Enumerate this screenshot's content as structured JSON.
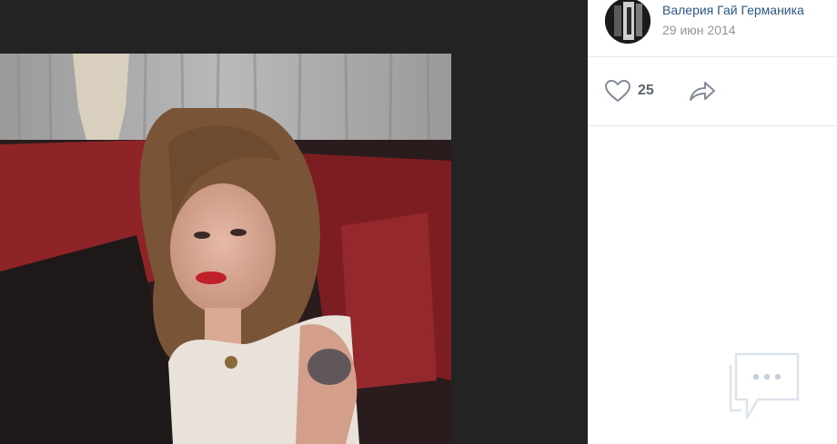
{
  "author": {
    "name": "Валерия Гай Германика",
    "date": "29 июн 2014"
  },
  "actions": {
    "likes": "25",
    "like_icon": "heart-icon",
    "share_icon": "share-arrow-icon"
  },
  "comments": {
    "empty_icon": "chat-bubble-icon"
  },
  "colors": {
    "link": "#2a5885",
    "muted": "#939393",
    "icon": "#828a99",
    "viewer_bg": "#222222"
  }
}
